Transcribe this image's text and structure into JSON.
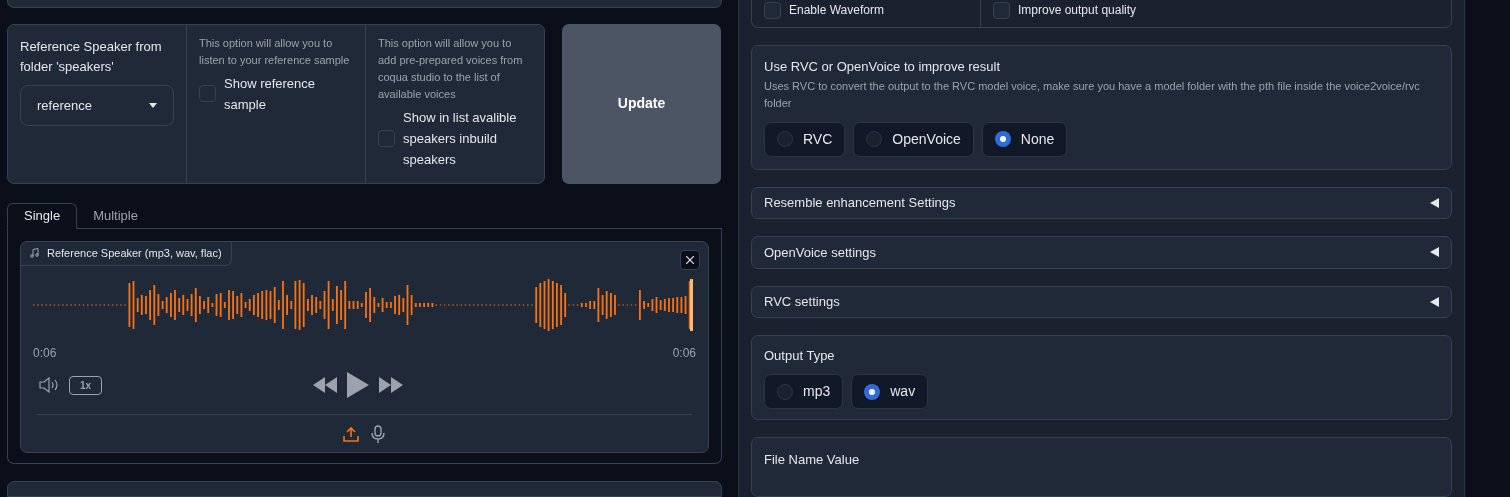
{
  "speaker_settings": {
    "dropdown": {
      "label": "Reference Speaker from folder 'speakers'",
      "value": "reference"
    },
    "show_reference": {
      "info": "This option will allow you to listen to your reference sample",
      "label": "Show reference sample",
      "checked": false
    },
    "show_inbuilt": {
      "info": "This option will allow you to add pre-prepared voices from coqua studio to the list of available voices",
      "label": "Show in list avalible speakers inbuild speakers",
      "checked": false
    },
    "update_button": "Update"
  },
  "tabs": [
    {
      "label": "Single",
      "selected": true
    },
    {
      "label": "Multiple",
      "selected": false
    }
  ],
  "audio": {
    "label": "Reference Speaker (mp3, wav, flac)",
    "time_current": "0:06",
    "time_total": "0:06",
    "speed": "1x"
  },
  "top_options": [
    {
      "label": "Enable Waveform",
      "checked": false
    },
    {
      "label": "Improve output quality",
      "checked": false
    }
  ],
  "improve": {
    "label": "Use RVC or OpenVoice to improve result",
    "info": "Uses RVC to convert the output to the RVC model voice, make sure you have a model folder with the pth file inside the voice2voice/rvc folder",
    "options": [
      {
        "label": "RVC",
        "selected": false
      },
      {
        "label": "OpenVoice",
        "selected": false
      },
      {
        "label": "None",
        "selected": true
      }
    ]
  },
  "accordions": [
    {
      "label": "Resemble enhancement Settings",
      "expanded": false
    },
    {
      "label": "OpenVoice settings",
      "expanded": false
    },
    {
      "label": "RVC settings",
      "expanded": false
    }
  ],
  "output_type": {
    "label": "Output Type",
    "options": [
      {
        "label": "mp3",
        "selected": false
      },
      {
        "label": "wav",
        "selected": true
      }
    ]
  },
  "file_name": {
    "label": "File Name Value"
  }
}
